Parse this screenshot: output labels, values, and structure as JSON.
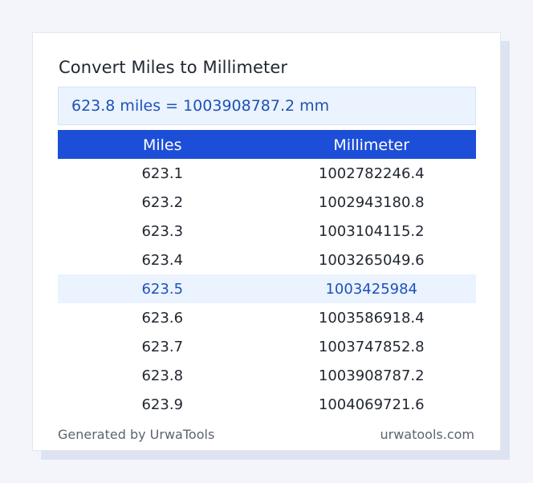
{
  "converter": {
    "title": "Convert Miles to Millimeter",
    "result": "623.8 miles = 1003908787.2 mm",
    "columns": [
      "Miles",
      "Millimeter"
    ],
    "rows": [
      {
        "miles": "623.1",
        "mm": "1002782246.4",
        "highlight": false
      },
      {
        "miles": "623.2",
        "mm": "1002943180.8",
        "highlight": false
      },
      {
        "miles": "623.3",
        "mm": "1003104115.2",
        "highlight": false
      },
      {
        "miles": "623.4",
        "mm": "1003265049.6",
        "highlight": false
      },
      {
        "miles": "623.5",
        "mm": "1003425984",
        "highlight": true
      },
      {
        "miles": "623.6",
        "mm": "1003586918.4",
        "highlight": false
      },
      {
        "miles": "623.7",
        "mm": "1003747852.8",
        "highlight": false
      },
      {
        "miles": "623.8",
        "mm": "1003908787.2",
        "highlight": false
      },
      {
        "miles": "623.9",
        "mm": "1004069721.6",
        "highlight": false
      }
    ]
  },
  "footer": {
    "generated_by": "Generated by UrwaTools",
    "site": "urwatools.com"
  },
  "colors": {
    "header_bg": "#1d4ed8",
    "result_bg": "#eaf3fe",
    "accent_text": "#1f52b8"
  }
}
